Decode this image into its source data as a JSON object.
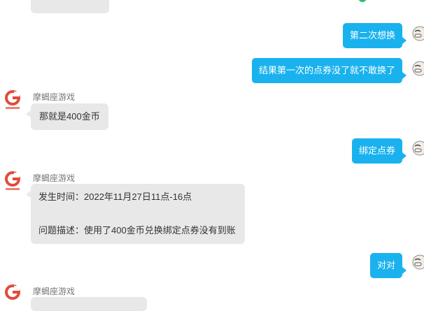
{
  "bot_name": "摩蝎座游戏",
  "colors": {
    "accent": "#1ab2ee",
    "bot_bubble": "#e8e8e8",
    "logo_red": "#e24a3b",
    "status_green": "#2bbf6a"
  },
  "messages": [
    {
      "role": "user",
      "text": "第二次想换"
    },
    {
      "role": "user",
      "text": "结果第一次的点券没了就不敢换了"
    },
    {
      "role": "bot",
      "sender": "摩蝎座游戏",
      "text": "那就是400金币"
    },
    {
      "role": "user",
      "text": "绑定点券"
    },
    {
      "role": "bot",
      "sender": "摩蝎座游戏",
      "lines": [
        "发生时间：2022年11月27日11点-16点",
        "问题描述：使用了400金币兑换绑定点券没有到账"
      ]
    },
    {
      "role": "user",
      "text": "对对"
    },
    {
      "role": "bot",
      "sender": "摩蝎座游戏",
      "text": ""
    }
  ],
  "icons": {
    "bot_avatar": "game-logo-icon",
    "user_avatar": "face-avatar-icon",
    "status": "online-dot-icon"
  }
}
